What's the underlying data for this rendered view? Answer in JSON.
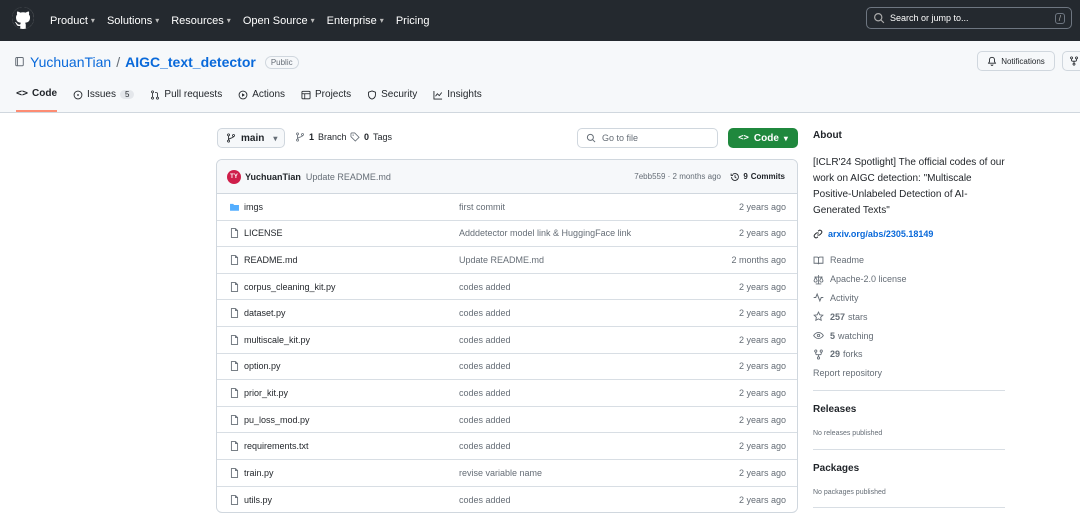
{
  "header": {
    "nav": [
      "Product",
      "Solutions",
      "Resources",
      "Open Source",
      "Enterprise",
      "Pricing"
    ],
    "search_placeholder": "Search or jump to...",
    "search_shortcut": "/"
  },
  "repo": {
    "owner": "YuchuanTian",
    "separator": "/",
    "name": "AIGC_text_detector",
    "visibility": "Public",
    "notifications_label": "Notifications",
    "tabs": [
      {
        "label": "Code",
        "icon": "code-icon",
        "active": true
      },
      {
        "label": "Issues",
        "icon": "issue-icon",
        "count": "5"
      },
      {
        "label": "Pull requests",
        "icon": "pull-request-icon"
      },
      {
        "label": "Actions",
        "icon": "play-icon"
      },
      {
        "label": "Projects",
        "icon": "table-icon"
      },
      {
        "label": "Security",
        "icon": "shield-icon"
      },
      {
        "label": "Insights",
        "icon": "graph-icon"
      }
    ]
  },
  "controls": {
    "branch": "main",
    "branches_count": "1",
    "branches_label": "Branch",
    "tags_count": "0",
    "tags_label": "Tags",
    "go_to_file": "Go to file",
    "code_button": "Code"
  },
  "latest_commit": {
    "avatar_initials": "TY",
    "user": "YuchuanTian",
    "message": "Update README.md",
    "meta": "7ebb559 · 2 months ago",
    "commits_count": "9",
    "commits_label": "Commits"
  },
  "files": [
    {
      "name": "imgs",
      "type": "folder",
      "message": "first commit",
      "date": "2 years ago"
    },
    {
      "name": "LICENSE",
      "type": "file",
      "message": "Adddetector model link & HuggingFace link",
      "date": "2 years ago"
    },
    {
      "name": "README.md",
      "type": "file",
      "message": "Update README.md",
      "date": "2 months ago"
    },
    {
      "name": "corpus_cleaning_kit.py",
      "type": "file",
      "message": "codes added",
      "date": "2 years ago"
    },
    {
      "name": "dataset.py",
      "type": "file",
      "message": "codes added",
      "date": "2 years ago"
    },
    {
      "name": "multiscale_kit.py",
      "type": "file",
      "message": "codes added",
      "date": "2 years ago"
    },
    {
      "name": "option.py",
      "type": "file",
      "message": "codes added",
      "date": "2 years ago"
    },
    {
      "name": "prior_kit.py",
      "type": "file",
      "message": "codes added",
      "date": "2 years ago"
    },
    {
      "name": "pu_loss_mod.py",
      "type": "file",
      "message": "codes added",
      "date": "2 years ago"
    },
    {
      "name": "requirements.txt",
      "type": "file",
      "message": "codes added",
      "date": "2 years ago"
    },
    {
      "name": "train.py",
      "type": "file",
      "message": "revise variable name",
      "date": "2 years ago"
    },
    {
      "name": "utils.py",
      "type": "file",
      "message": "codes added",
      "date": "2 years ago"
    }
  ],
  "about": {
    "title": "About",
    "description": "[ICLR'24 Spotlight] The official codes of our work on AIGC detection: \"Multiscale Positive-Unlabeled Detection of AI-Generated Texts\"",
    "link": "arxiv.org/abs/2305.18149",
    "readme": "Readme",
    "license": "Apache-2.0 license",
    "activity": "Activity",
    "stars_count": "257",
    "stars_label": "stars",
    "watching_count": "5",
    "watching_label": "watching",
    "forks_count": "29",
    "forks_label": "forks",
    "report": "Report repository"
  },
  "releases": {
    "title": "Releases",
    "empty": "No releases published"
  },
  "packages": {
    "title": "Packages",
    "empty": "No packages published"
  },
  "colors": {
    "header_bg": "#24292f",
    "link": "#0969da",
    "code_button": "#1f883d",
    "active_tab": "#fd8c73"
  }
}
